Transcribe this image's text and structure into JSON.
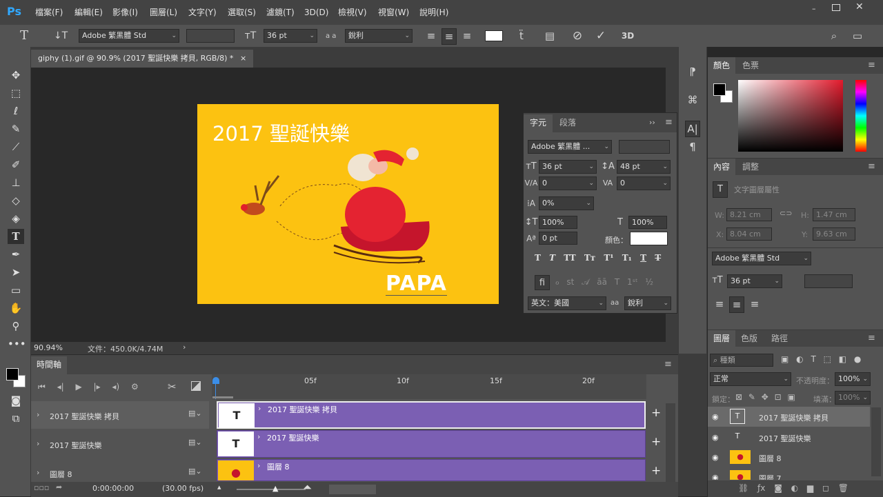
{
  "app": {
    "logo": "Ps"
  },
  "menu": [
    "檔案(F)",
    "編輯(E)",
    "影像(I)",
    "圖層(L)",
    "文字(Y)",
    "選取(S)",
    "濾鏡(T)",
    "3D(D)",
    "檢視(V)",
    "視窗(W)",
    "說明(H)"
  ],
  "options": {
    "font_family": "Adobe 繁黑體 Std",
    "font_size": "36 pt",
    "anti_alias": "銳利",
    "aa_label": "a a"
  },
  "document": {
    "tab_title": "giphy (1).gif @ 90.9% (2017 聖誕快樂 拷貝, RGB/8) *",
    "close": "×",
    "zoom": "90.94%",
    "file_info": "文件：450.0K/4.74M"
  },
  "canvas": {
    "heading": "2017 聖誕快樂",
    "sign": "PAPA",
    "bg": "#fcc211"
  },
  "character_panel": {
    "tabs": [
      "字元",
      "段落"
    ],
    "font": "Adobe 繁黑體 ...",
    "size": "36 pt",
    "leading": "48 pt",
    "kerning": "0",
    "tracking": "0",
    "baseline_pct": "0%",
    "vscale": "100%",
    "hscale": "100%",
    "shift": "0 pt",
    "color_label": "顏色：",
    "language": "英文：美國",
    "anti_alias": "銳利"
  },
  "color_panel": {
    "tabs": [
      "顏色",
      "色票"
    ]
  },
  "properties_panel": {
    "tabs": [
      "內容",
      "調整"
    ],
    "header": "文字圖層屬性",
    "w_label": "W:",
    "w": "8.21 cm",
    "h_label": "H:",
    "h": "1.47 cm",
    "x_label": "X:",
    "x": "8.04 cm",
    "y_label": "Y:",
    "y": "9.63 cm",
    "font": "Adobe 繁黑體 Std",
    "size": "36 pt"
  },
  "layers_panel": {
    "tabs": [
      "圖層",
      "色版",
      "路徑"
    ],
    "search": "種類",
    "blend": "正常",
    "opacity_label": "不透明度：",
    "opacity": "100%",
    "lock_label": "鎖定：",
    "fill_label": "填滿：",
    "fill": "100%",
    "layers": [
      "2017 聖誕快樂 拷貝",
      "2017 聖誕快樂",
      "圖層 8",
      "圖層 7"
    ]
  },
  "timeline": {
    "title": "時間軸",
    "ticks": [
      "05f",
      "10f",
      "15f",
      "20f"
    ],
    "tracks": [
      "2017 聖誕快樂 拷貝",
      "2017 聖誕快樂",
      "圖層 8"
    ],
    "time": "0:00:00:00",
    "fps": "(30.00 fps)"
  }
}
